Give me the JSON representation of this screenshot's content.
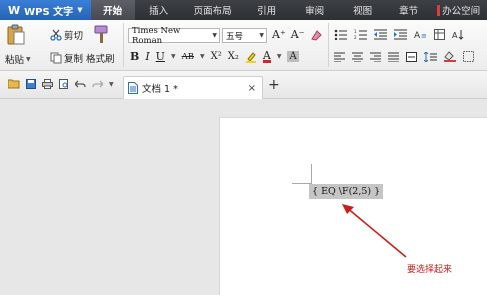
{
  "menubar": {
    "app_name": "WPS 文字",
    "tabs": [
      "开始",
      "插入",
      "页面布局",
      "引用",
      "审阅",
      "视图",
      "章节",
      "办公空间"
    ]
  },
  "ribbon": {
    "paste_label": "粘贴",
    "cut_label": "剪切",
    "copy_label": "复制",
    "format_painter_label": "格式刷",
    "font_name": "Times New Roman",
    "font_size": "五号",
    "bold": "B",
    "italic": "I",
    "underline": "U",
    "strikethrough": "AB",
    "superscript": "X²",
    "subscript": "X₂",
    "font_color": "A",
    "char_shading": "A",
    "grow_font": "A⁺",
    "shrink_font": "A⁻"
  },
  "docbar": {
    "doc_title": "文档 1 *",
    "close_glyph": "×",
    "new_tab_glyph": "+"
  },
  "document": {
    "field_code": "{ EQ \\F(2,5) }",
    "annotation": "要选择起来"
  },
  "colors": {
    "accent_blue": "#2f72c9",
    "annotation_red": "#c8201d",
    "field_highlight": "#c5c5c5"
  }
}
